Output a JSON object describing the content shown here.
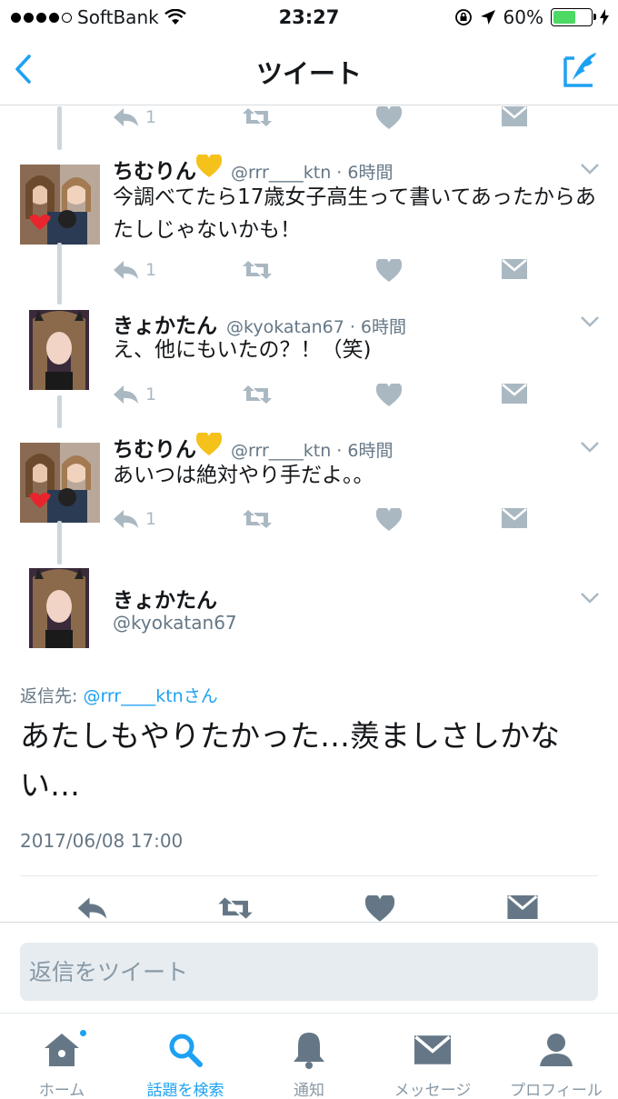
{
  "status_bar": {
    "carrier": "SoftBank",
    "time": "23:27",
    "battery_percent": "60%",
    "battery_level": 0.6
  },
  "nav": {
    "title": "ツイート"
  },
  "thread": [
    {
      "actions": {
        "reply_count": "1"
      }
    },
    {
      "name": "ちむりん",
      "handle": "@rrr____ktn · 6時間",
      "text": "今調べてたら17歳女子高生って書いてあったからあたしじゃないかも！",
      "actions": {
        "reply_count": "1"
      }
    },
    {
      "name": "きょかたん",
      "handle": "@kyokatan67 · 6時間",
      "text": "え、他にもいたの？！（笑)",
      "actions": {
        "reply_count": "1"
      }
    },
    {
      "name": "ちむりん",
      "handle": "@rrr____ktn · 6時間",
      "text": "あいつは絶対やり手だよ。。",
      "actions": {
        "reply_count": "1"
      }
    }
  ],
  "main_tweet": {
    "name": "きょかたん",
    "handle": "@kyokatan67",
    "reply_label": "返信先:",
    "reply_target": "@rrr____ktnさん",
    "text": "あたしもやりたかった…羨ましさしかない…",
    "date": "2017/06/08 17:00"
  },
  "reply_box": {
    "placeholder": "返信をツイート"
  },
  "tabs": [
    {
      "label": "ホーム",
      "icon": "home-icon"
    },
    {
      "label": "話題を検索",
      "icon": "search-icon",
      "active": true
    },
    {
      "label": "通知",
      "icon": "bell-icon"
    },
    {
      "label": "メッセージ",
      "icon": "envelope-icon"
    },
    {
      "label": "プロフィール",
      "icon": "profile-icon"
    }
  ],
  "colors": {
    "accent": "#1da1f2",
    "action_gray": "#aab8c2",
    "text_gray": "#657786"
  }
}
